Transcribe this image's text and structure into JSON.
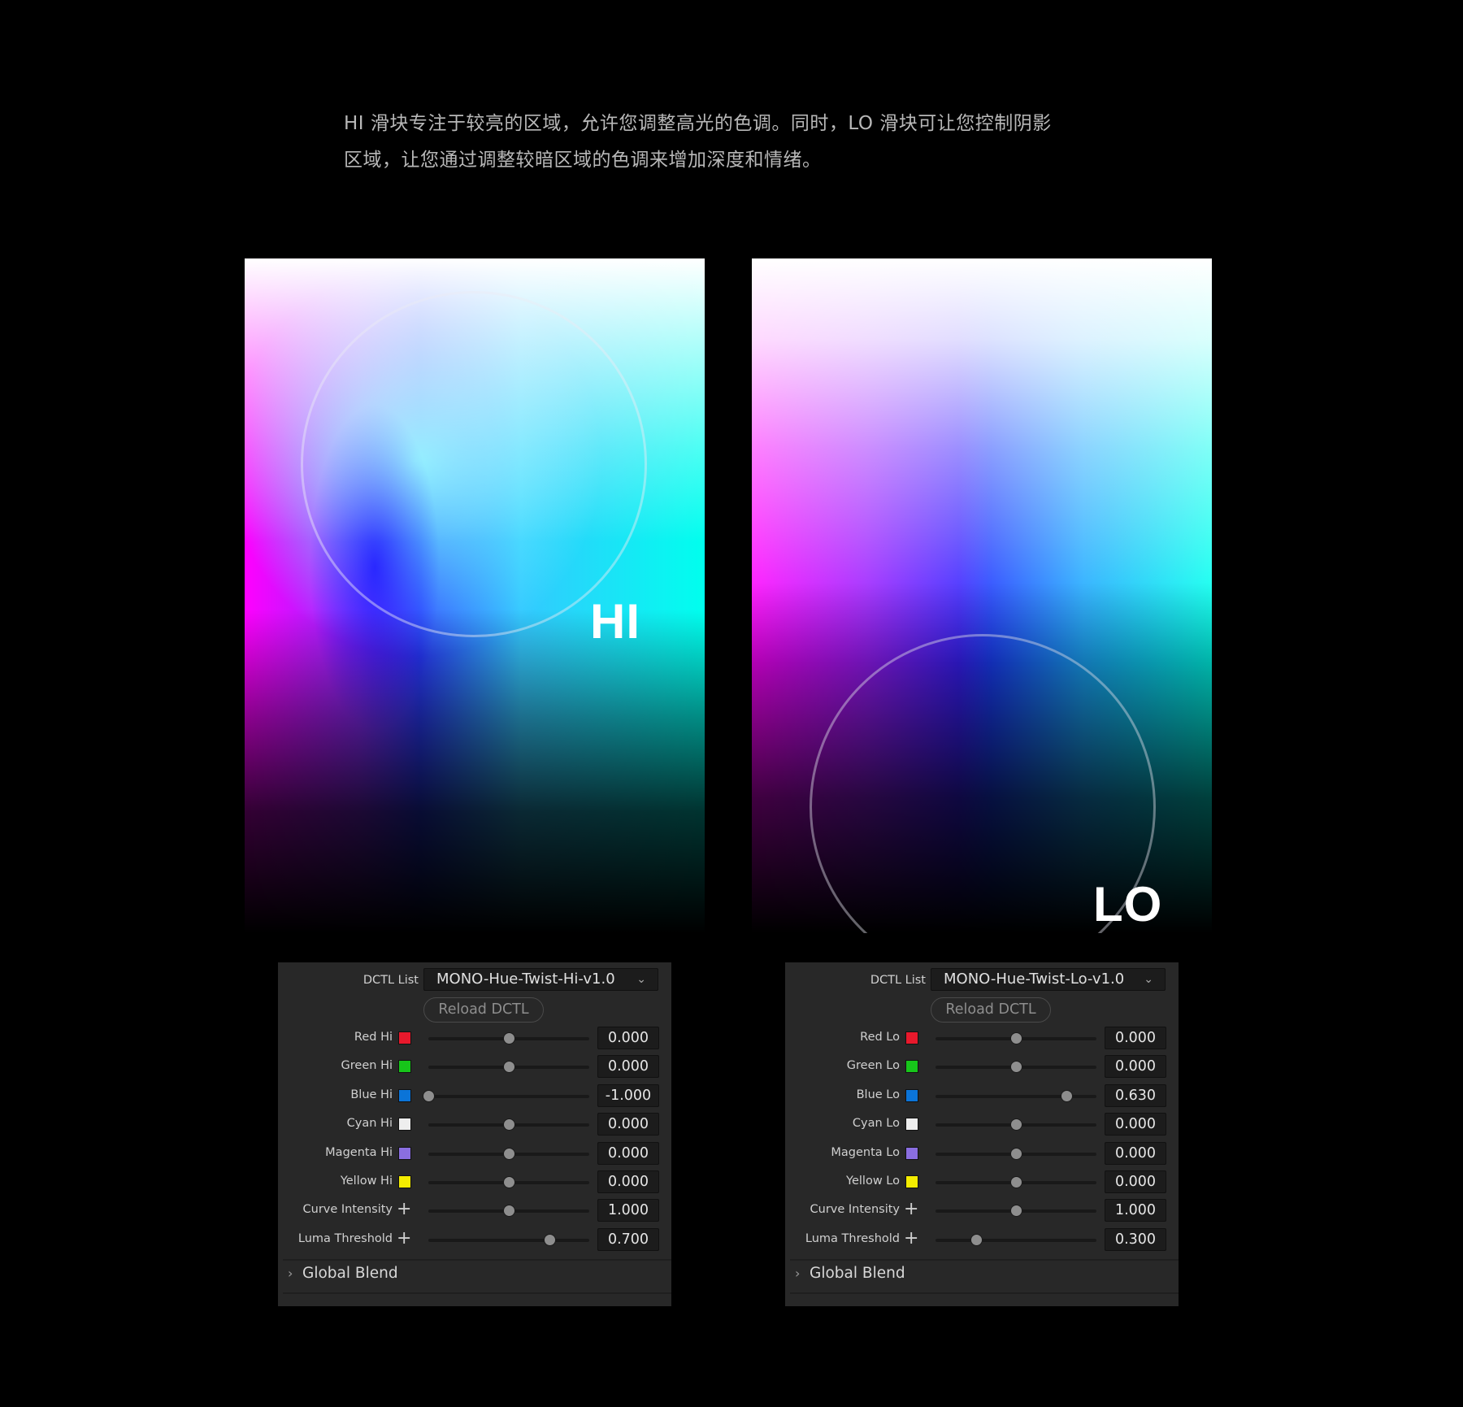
{
  "intro": {
    "line1": "HI 滑块专注于较亮的区域，允许您调整高光的色调。同时，LO 滑块可让您控制阴影",
    "line2": "区域，让您通过调整较暗区域的色调来增加深度和情绪。"
  },
  "images": {
    "hi": {
      "label": "HI"
    },
    "lo": {
      "label": "LO"
    }
  },
  "panels": {
    "hi": {
      "dctl_label": "DCTL List",
      "dctl_value": "MONO-Hue-Twist-Hi-v1.0",
      "reload_label": "Reload DCTL",
      "global_blend_label": "Global Blend",
      "params": [
        {
          "label": "Red Hi",
          "icon": "swatch",
          "color": "#e8192c",
          "value": "0.000",
          "level": 0.5
        },
        {
          "label": "Green Hi",
          "icon": "swatch",
          "color": "#17c51a",
          "value": "0.000",
          "level": 0.5
        },
        {
          "label": "Blue Hi",
          "icon": "swatch",
          "color": "#0b74d8",
          "value": "-1.000",
          "level": 0.0
        },
        {
          "label": "Cyan Hi",
          "icon": "swatch",
          "color": "#eeeeee",
          "value": "0.000",
          "level": 0.5
        },
        {
          "label": "Magenta Hi",
          "icon": "swatch",
          "color": "#8a6ee0",
          "value": "0.000",
          "level": 0.5
        },
        {
          "label": "Yellow Hi",
          "icon": "swatch",
          "color": "#f4ec00",
          "value": "0.000",
          "level": 0.5
        },
        {
          "label": "Curve Intensity",
          "icon": "plus",
          "value": "1.000",
          "level": 0.5
        },
        {
          "label": "Luma Threshold",
          "icon": "plus",
          "value": "0.700",
          "level": 0.75
        }
      ]
    },
    "lo": {
      "dctl_label": "DCTL List",
      "dctl_value": "MONO-Hue-Twist-Lo-v1.0",
      "reload_label": "Reload DCTL",
      "global_blend_label": "Global Blend",
      "params": [
        {
          "label": "Red Lo",
          "icon": "swatch",
          "color": "#e8192c",
          "value": "0.000",
          "level": 0.5
        },
        {
          "label": "Green Lo",
          "icon": "swatch",
          "color": "#17c51a",
          "value": "0.000",
          "level": 0.5
        },
        {
          "label": "Blue Lo",
          "icon": "swatch",
          "color": "#0b74d8",
          "value": "0.630",
          "level": 0.815
        },
        {
          "label": "Cyan Lo",
          "icon": "swatch",
          "color": "#eeeeee",
          "value": "0.000",
          "level": 0.5
        },
        {
          "label": "Magenta Lo",
          "icon": "swatch",
          "color": "#8a6ee0",
          "value": "0.000",
          "level": 0.5
        },
        {
          "label": "Yellow Lo",
          "icon": "swatch",
          "color": "#f4ec00",
          "value": "0.000",
          "level": 0.5
        },
        {
          "label": "Curve Intensity",
          "icon": "plus",
          "value": "1.000",
          "level": 0.5
        },
        {
          "label": "Luma Threshold",
          "icon": "plus",
          "value": "0.300",
          "level": 0.25
        }
      ]
    }
  },
  "icons": {
    "dropdown": "chevron-down-icon",
    "expand": "chevron-right-icon",
    "plus": "plus-icon"
  }
}
